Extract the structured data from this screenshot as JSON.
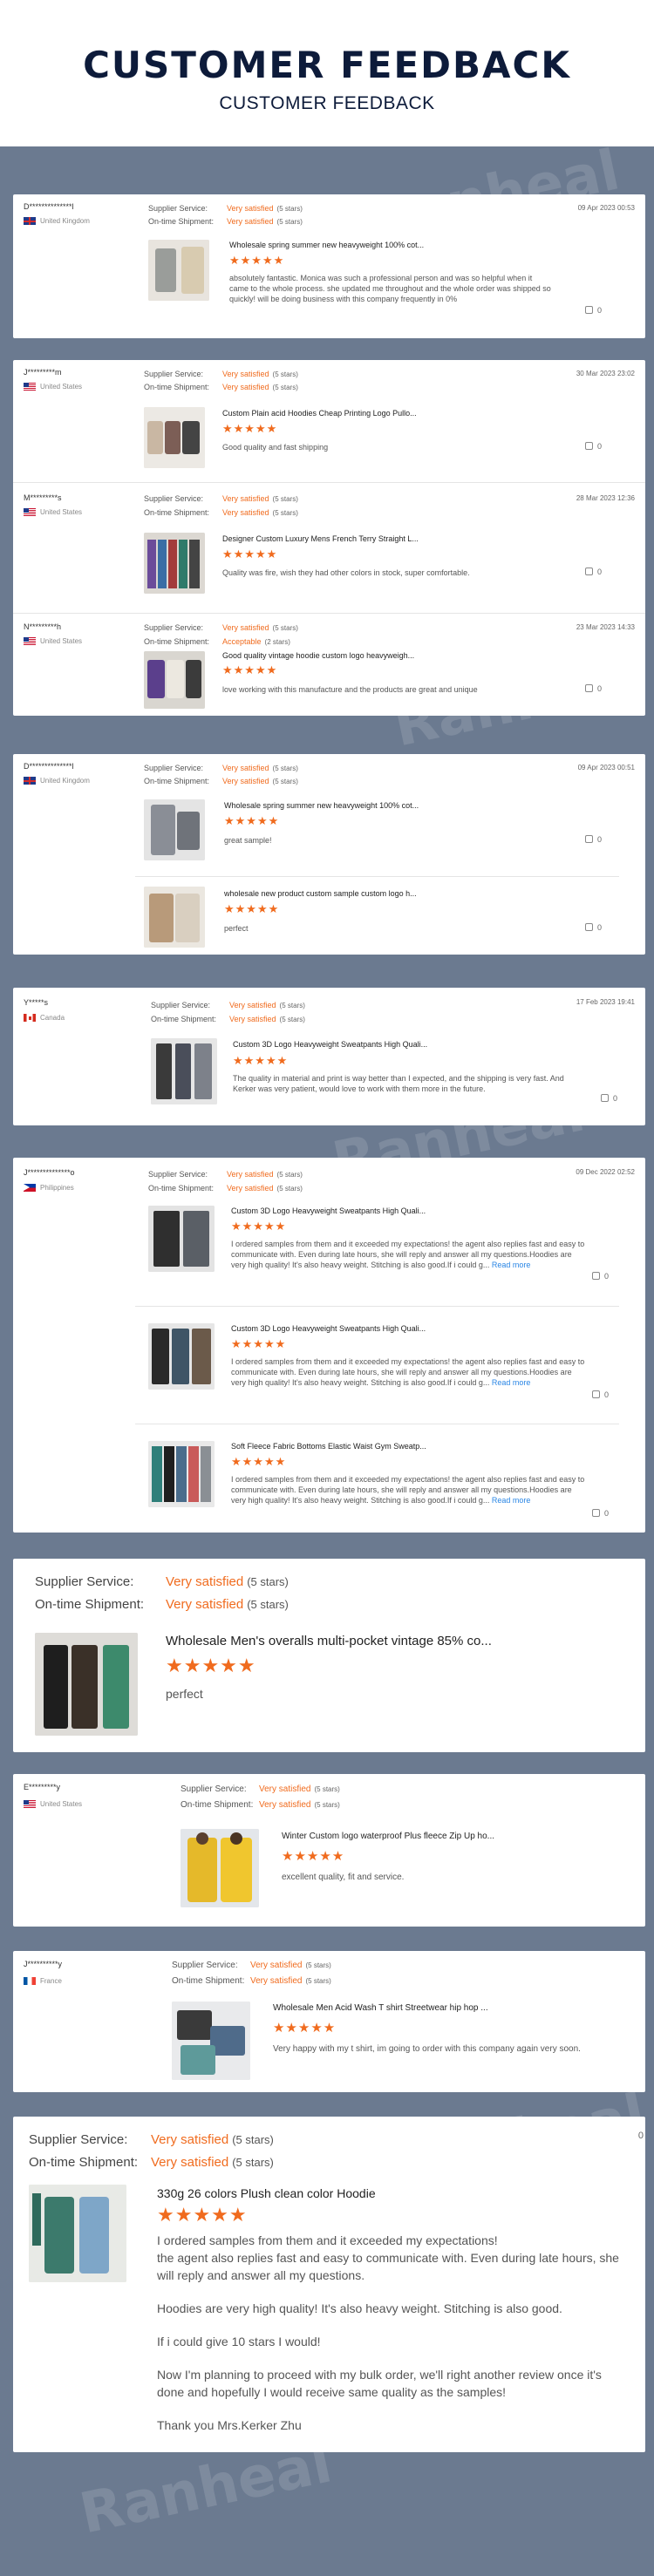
{
  "header": {
    "title": "CUSTOMER FEEDBACK",
    "subtitle": "CUSTOMER FEEDBACK"
  },
  "watermark": "Ranheal",
  "labels": {
    "supplier_service": "Supplier Service:",
    "on_time_shipment": "On-time Shipment:",
    "stars_5": "(5 stars)",
    "stars_2": "(2 stars)",
    "very_satisfied": "Very satisfied",
    "acceptable": "Acceptable",
    "read_more": "Read more",
    "like_count": "0",
    "five_stars": "★★★★★"
  },
  "reviews": [
    {
      "user": "D**************l",
      "country": "United Kingdom",
      "date": "09 Apr 2023 00:53",
      "product": "Wholesale spring summer new heavyweight 100% cot...",
      "text": "absolutely fantastic. Monica was such a professional person and was so helpful when it came to the whole process. she updated me throughout and the whole order was shipped so quickly! will be doing business with this company frequently in 0%"
    },
    {
      "user": "J*********m",
      "country": "United States",
      "date": "30 Mar 2023 23:02",
      "product": "Custom Plain acid Hoodies Cheap Printing Logo Pullo...",
      "text": "Good quality and fast shipping"
    },
    {
      "user": "M*********s",
      "country": "United States",
      "date": "28 Mar 2023 12:36",
      "product": "Designer Custom Luxury Mens French Terry Straight L...",
      "text": "Quality was fire, wish they had other colors in stock, super comfortable."
    },
    {
      "user": "N*********h",
      "country": "United States",
      "date": "23 Mar 2023 14:33",
      "product": "Good quality vintage hoodie custom logo heavyweigh...",
      "text": "love working with this manufacture and the products are great and unique"
    },
    {
      "user": "D**************l",
      "country": "United Kingdom",
      "date": "09 Apr 2023 00:51",
      "product": "Wholesale spring summer new heavyweight 100% cot...",
      "text": "great sample!",
      "product2": "wholesale new product custom sample custom logo h...",
      "text2": "perfect"
    },
    {
      "user": "Y*****s",
      "country": "Canada",
      "date": "17 Feb 2023 19:41",
      "product": "Custom 3D Logo Heavyweight Sweatpants High Quali...",
      "text": "The quality in material and print is way better than I expected, and the shipping is very fast. And Kerker was very patient, would love to work with them more in the future."
    },
    {
      "user": "J**************o",
      "country": "Philippines",
      "date": "09 Dec 2022 02:52",
      "product": "Custom 3D Logo Heavyweight Sweatpants High Quali...",
      "product3": "Soft Fleece Fabric Bottoms Elastic Waist Gym Sweatp...",
      "text": "I ordered samples from them and it exceeded my expectations! the agent also replies fast and easy to communicate with. Even during late hours, she will reply and answer all my questions.Hoodies are very high quality! It's also heavy weight. Stitching is also good.If i could g..."
    },
    {
      "product": "Wholesale Men's overalls multi-pocket vintage 85% co...",
      "text": "perfect"
    },
    {
      "user": "E*********y",
      "country": "United States",
      "product": "Winter Custom logo waterproof Plus fleece Zip Up ho...",
      "text": "excellent quality, fit and service."
    },
    {
      "user": "J**********y",
      "country": "France",
      "product": "Wholesale Men Acid Wash T shirt Streetwear hip hop ...",
      "text": "Very happy with my t shirt, im going to order with this company again very soon."
    },
    {
      "product": "330g 26 colors Plush clean color Hoodie",
      "p1": "I ordered samples from them and it exceeded my expectations!",
      "p2": "the agent also replies fast and easy to communicate with. Even during late hours, she will reply and answer all my questions.",
      "p3": "Hoodies are very high quality! It's also heavy weight. Stitching is also good.",
      "p4": "If i could give 10 stars I would!",
      "p5": "Now I'm planning to proceed with my bulk order, we'll right another review once it's done and hopefully I would receive same quality as the samples!",
      "p6": "Thank you Mrs.Kerker Zhu"
    }
  ],
  "colors": {
    "accent": "#f06b1e",
    "navy": "#0d1b3a",
    "panel": "#6b7a90",
    "link": "#2a86e5"
  }
}
